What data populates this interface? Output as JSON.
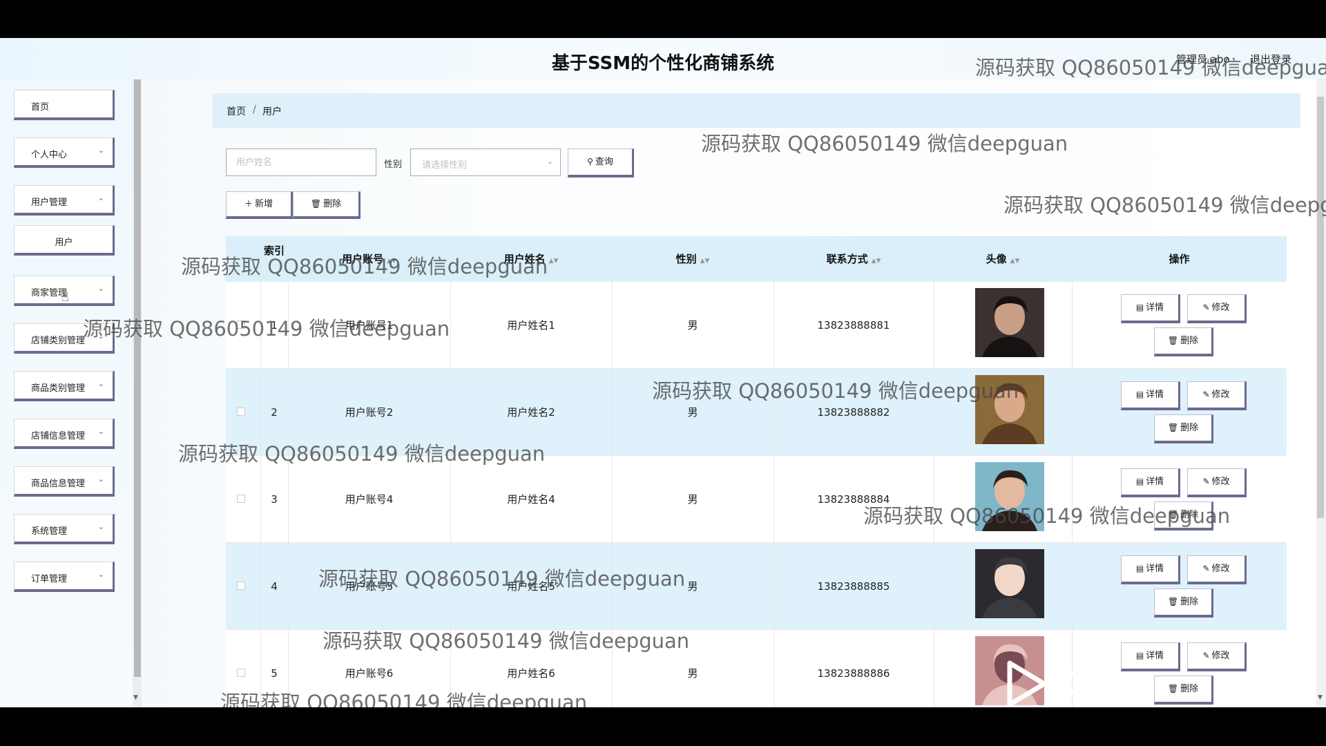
{
  "header": {
    "title": "基于SSM的个性化商铺系统",
    "user": "管理员 abo",
    "logout": "退出登录"
  },
  "sidebar": {
    "items": [
      {
        "label": "首页",
        "has_chevron": false
      },
      {
        "label": "个人中心",
        "has_chevron": true
      },
      {
        "label": "用户管理",
        "has_chevron": true
      },
      {
        "label": "用户",
        "has_chevron": false,
        "sub": true
      },
      {
        "label": "商家管理",
        "has_chevron": true
      },
      {
        "label": "店铺类别管理",
        "has_chevron": true
      },
      {
        "label": "商品类别管理",
        "has_chevron": true
      },
      {
        "label": "店铺信息管理",
        "has_chevron": true
      },
      {
        "label": "商品信息管理",
        "has_chevron": true
      },
      {
        "label": "系统管理",
        "has_chevron": true
      },
      {
        "label": "订单管理",
        "has_chevron": true
      }
    ]
  },
  "breadcrumb": {
    "home": "首页",
    "separator": "/",
    "current": "用户"
  },
  "search": {
    "name_placeholder": "用户姓名",
    "gender_label": "性别",
    "gender_placeholder": "请选择性别",
    "query_label": "查询"
  },
  "toolbar": {
    "add_label": "新增",
    "delete_label": "删除"
  },
  "table": {
    "columns": {
      "index": "索引",
      "account": "用户账号",
      "name": "用户姓名",
      "gender": "性别",
      "phone": "联系方式",
      "avatar": "头像",
      "ops": "操作"
    },
    "rows": [
      {
        "index": "1",
        "account": "用户账号1",
        "name": "用户姓名1",
        "gender": "男",
        "phone": "13823888881",
        "avatar_colors": [
          "#3a3130",
          "#c99f86",
          "#151212"
        ]
      },
      {
        "index": "2",
        "account": "用户账号2",
        "name": "用户姓名2",
        "gender": "男",
        "phone": "13823888882",
        "avatar_colors": [
          "#8a6a3a",
          "#d9a98a",
          "#5b3b22"
        ]
      },
      {
        "index": "3",
        "account": "用户账号4",
        "name": "用户姓名4",
        "gender": "男",
        "phone": "13823888884",
        "avatar_colors": [
          "#7fb7c9",
          "#e5b9a0",
          "#2a1f1d"
        ]
      },
      {
        "index": "4",
        "account": "用户账号5",
        "name": "用户姓名5",
        "gender": "男",
        "phone": "13823888885",
        "avatar_colors": [
          "#2b2b2f",
          "#f0d7c8",
          "#3a3a40"
        ]
      },
      {
        "index": "5",
        "account": "用户账号6",
        "name": "用户姓名6",
        "gender": "男",
        "phone": "13823888886",
        "avatar_colors": [
          "#c88f90",
          "#7a4a55",
          "#e8c4c0"
        ]
      }
    ],
    "row_actions": {
      "detail": "详情",
      "edit": "修改",
      "delete": "删除"
    }
  },
  "watermark": "源码获取 QQ86050149 微信deepguan",
  "colors": {
    "accent_border": "#6b6a8f",
    "breadcrumb_bg": "#dff0fb",
    "table_header_bg": "#daeffa",
    "row_alt_bg": "#dff1fb"
  }
}
